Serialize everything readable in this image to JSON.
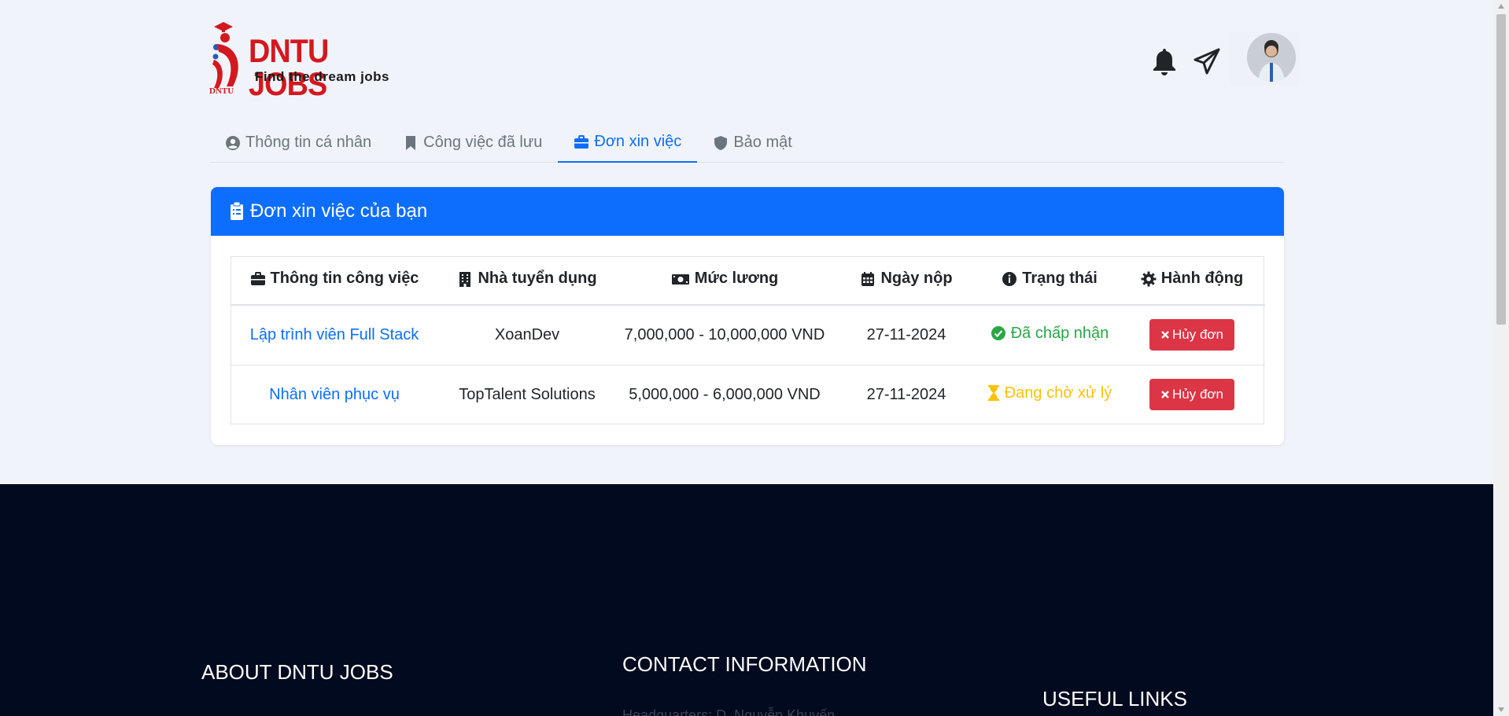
{
  "brand": {
    "title": "DNTU JOBS",
    "tagline": "Find the dream jobs",
    "mini": "DNTU",
    "color": "#d4181f"
  },
  "header": {
    "icons": [
      "bell-icon",
      "send-icon"
    ],
    "avatar": "user-avatar"
  },
  "tabs": [
    {
      "label": "Thông tin cá nhân",
      "icon": "user-circle-icon",
      "active": false
    },
    {
      "label": "Công việc đã lưu",
      "icon": "bookmark-icon",
      "active": false
    },
    {
      "label": "Đơn xin việc",
      "icon": "briefcase-icon",
      "active": true
    },
    {
      "label": "Bảo mật",
      "icon": "shield-icon",
      "active": false
    }
  ],
  "card": {
    "title": "Đơn xin việc của bạn",
    "icon": "clipboard-icon",
    "accent": "#0d6efd"
  },
  "table": {
    "columns": [
      {
        "label": "Thông tin công việc",
        "icon": "briefcase-icon"
      },
      {
        "label": "Nhà tuyển dụng",
        "icon": "building-icon"
      },
      {
        "label": "Mức lương",
        "icon": "money-icon"
      },
      {
        "label": "Ngày nộp",
        "icon": "calendar-icon"
      },
      {
        "label": "Trạng thái",
        "icon": "info-icon"
      },
      {
        "label": "Hành động",
        "icon": "gear-icon"
      }
    ],
    "rows": [
      {
        "job": "Lập trình viên Full Stack",
        "company": "XoanDev",
        "salary": "7,000,000 - 10,000,000 VND",
        "date": "27-11-2024",
        "status": "Đã chấp nhận",
        "status_color": "#28a745",
        "action": "Hủy đơn"
      },
      {
        "job": "Nhân viên phục vụ",
        "company": "TopTalent Solutions",
        "salary": "5,000,000 - 6,000,000 VND",
        "date": "27-11-2024",
        "status": "Đang chờ xử lý",
        "status_color": "#ffc107",
        "action": "Hủy đơn"
      }
    ]
  },
  "footer": {
    "about": "ABOUT DNTU JOBS",
    "contact": "CONTACT INFORMATION",
    "links": "USEFUL LINKS",
    "faded_text": "Headquarters: D. Nguyễn Khuyến",
    "background": "#020a1f"
  }
}
